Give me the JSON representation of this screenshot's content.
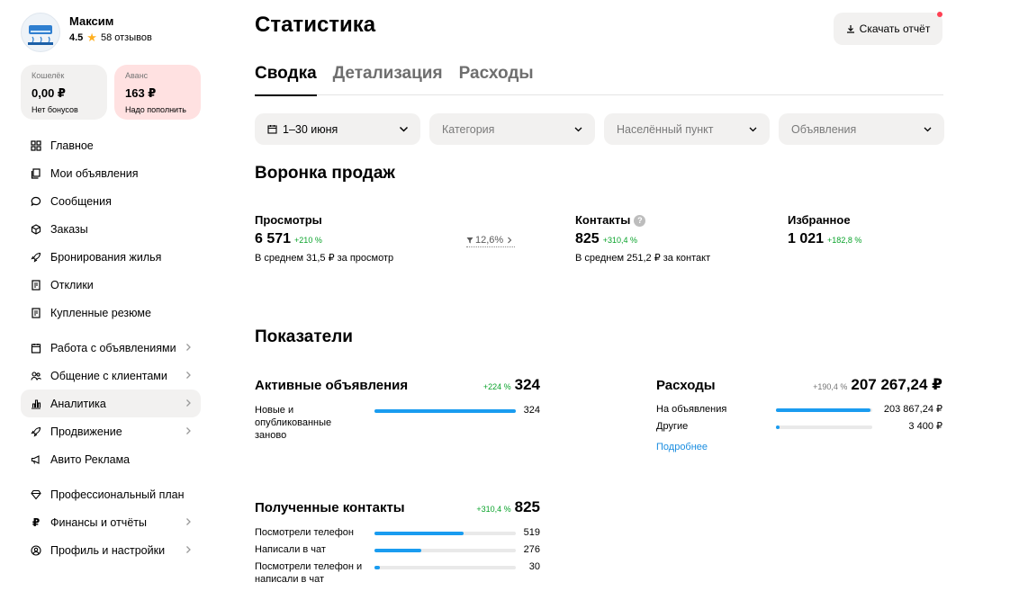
{
  "profile": {
    "name": "Максим",
    "rating": "4.5",
    "reviews": "58 отзывов",
    "avatar_icon": "air-conditioner-logo"
  },
  "wallet": {
    "label": "Кошелёк",
    "amount": "0,00 ₽",
    "sub": "Нет бонусов"
  },
  "advance": {
    "label": "Аванс",
    "amount": "163 ₽",
    "sub": "Надо пополнить"
  },
  "nav": {
    "items": [
      {
        "label": "Главное",
        "icon": "grid-icon"
      },
      {
        "label": "Мои объявления",
        "icon": "copy-icon"
      },
      {
        "label": "Сообщения",
        "icon": "chat-icon"
      },
      {
        "label": "Заказы",
        "icon": "box-icon"
      },
      {
        "label": "Бронирования жилья",
        "icon": "rocket-icon"
      },
      {
        "label": "Отклики",
        "icon": "doc-icon"
      },
      {
        "label": "Купленные резюме",
        "icon": "doc-icon"
      },
      {
        "label": "Работа с объявлениями",
        "icon": "calendar-icon"
      },
      {
        "label": "Общение с клиентами",
        "icon": "users-icon"
      },
      {
        "label": "Аналитика",
        "icon": "chart-icon"
      },
      {
        "label": "Продвижение",
        "icon": "rocket-icon"
      },
      {
        "label": "Авито Реклама",
        "icon": "ad-icon"
      },
      {
        "label": "Профессиональный план",
        "icon": "diamond-icon"
      },
      {
        "label": "Финансы и отчёты",
        "icon": "ruble-icon"
      },
      {
        "label": "Профиль и настройки",
        "icon": "user-circle-icon"
      }
    ]
  },
  "header": {
    "title": "Статистика",
    "download_label": "Скачать отчёт"
  },
  "tabs": [
    {
      "label": "Сводка",
      "active": true
    },
    {
      "label": "Детализация",
      "active": false
    },
    {
      "label": "Расходы",
      "active": false
    }
  ],
  "filters": {
    "period": "1–30 июня",
    "category": "Категория",
    "city": "Населённый пункт",
    "ads": "Объявления"
  },
  "funnel": {
    "title": "Воронка продаж",
    "views": {
      "label": "Просмотры",
      "value": "6 571",
      "delta": "+210 %",
      "note": "В среднем 31,5 ₽ за просмотр"
    },
    "conversion": "12,6%",
    "contacts": {
      "label": "Контакты",
      "value": "825",
      "delta": "+310,4 %",
      "note": "В среднем 251,2 ₽ за контакт"
    },
    "favorites": {
      "label": "Избранное",
      "value": "1 021",
      "delta": "+182,8 %"
    }
  },
  "indicators": {
    "title": "Показатели",
    "active_ads": {
      "title": "Активные объявления",
      "delta": "+224 %",
      "total": "324",
      "rows": [
        {
          "label": "Новые и опубликованные заново",
          "value": "324",
          "fill": 1.0
        }
      ]
    },
    "expenses": {
      "title": "Расходы",
      "delta": "+190,4 %",
      "total": "207 267,24 ₽",
      "rows": [
        {
          "label": "На объявления",
          "value": "203 867,24 ₽",
          "fill": 0.98
        },
        {
          "label": "Другие",
          "value": "3 400 ₽",
          "fill": 0.04
        }
      ],
      "more": "Подробнее"
    },
    "contacts": {
      "title": "Полученные контакты",
      "delta": "+310,4 %",
      "total": "825",
      "rows": [
        {
          "label": "Посмотрели телефон",
          "value": "519",
          "fill": 0.63
        },
        {
          "label": "Написали в чат",
          "value": "276",
          "fill": 0.33
        },
        {
          "label": "Посмотрели телефон и написали в чат",
          "value": "30",
          "fill": 0.04
        }
      ]
    }
  },
  "colors": {
    "accent": "#1a9cf0",
    "positive": "#0aa32b",
    "wallet_pink": "#ffe1e1",
    "surface": "#f2f1f0",
    "badge": "#ff4053"
  }
}
